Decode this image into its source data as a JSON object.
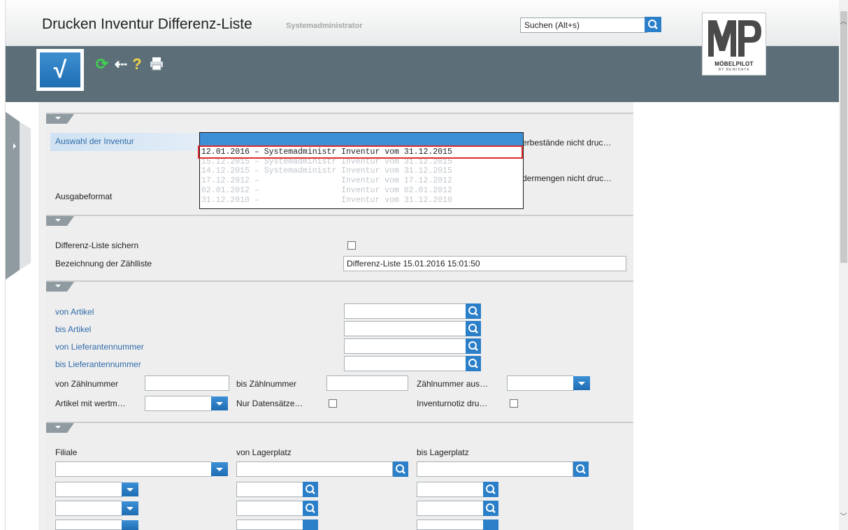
{
  "header": {
    "title": "Drucken Inventur Differenz-Liste",
    "user": "Systemadministrator",
    "search_value": "Suchen (Alt+s)"
  },
  "logo": {
    "mark": "MP",
    "name": "MÖBELPILOT",
    "sub": "BY BEWIDATA"
  },
  "toolbar": {
    "confirm_icon": "checkmark-icon",
    "refresh_glyph": "⟳",
    "back_glyph": "⇠",
    "help_glyph": "?",
    "print_glyph": "🖶"
  },
  "section1": {
    "auswahl_label": "Auswahl der Inventur",
    "ausgabe_label": "Ausgabeformat",
    "right_text_1": "erbestände nicht druc…",
    "right_text_2": "dermengen nicht druc…",
    "dropdown_options": [
      "12.01.2016 – Systemadministr Inventur vom 31.12.2015",
      "15.12.2015 – Systemadministr Inventur vom 31.12.2015",
      "14.12.2015 – Systemadministr Inventur vom 31.12.2015",
      "17.12.2012 –                 Inventur vom 17.12.2012",
      "02.01.2012 –                 Inventur vom 02.01.2012",
      "31.12.2010 –                 Inventur vom 31.12.2010"
    ]
  },
  "section2": {
    "sichern_label": "Differenz-Liste sichern",
    "bezeichnung_label": "Bezeichnung der Zählliste",
    "bezeichnung_value": "Differenz-Liste 15.01.2016 15:01:50"
  },
  "section3": {
    "von_artikel": "von Artikel",
    "bis_artikel": "bis Artikel",
    "von_lieferant": "von Lieferantennummer",
    "bis_lieferant": "bis Lieferantennummer",
    "von_zaehl": "von Zählnummer",
    "bis_zaehl": "bis Zählnummer",
    "zaehl_aus": "Zählnummer aus…",
    "artikel_wert": "Artikel mit wertm…",
    "nur_daten": "Nur Datensätze…",
    "inventurnotiz": "Inventurnotiz dru…"
  },
  "section4": {
    "filiale": "Filiale",
    "von_lager": "von Lagerplatz",
    "bis_lager": "bis Lagerplatz"
  },
  "colors": {
    "accent": "#2f6aaa",
    "toolbar": "#5c6f78",
    "highlight": "#e02b2b"
  }
}
